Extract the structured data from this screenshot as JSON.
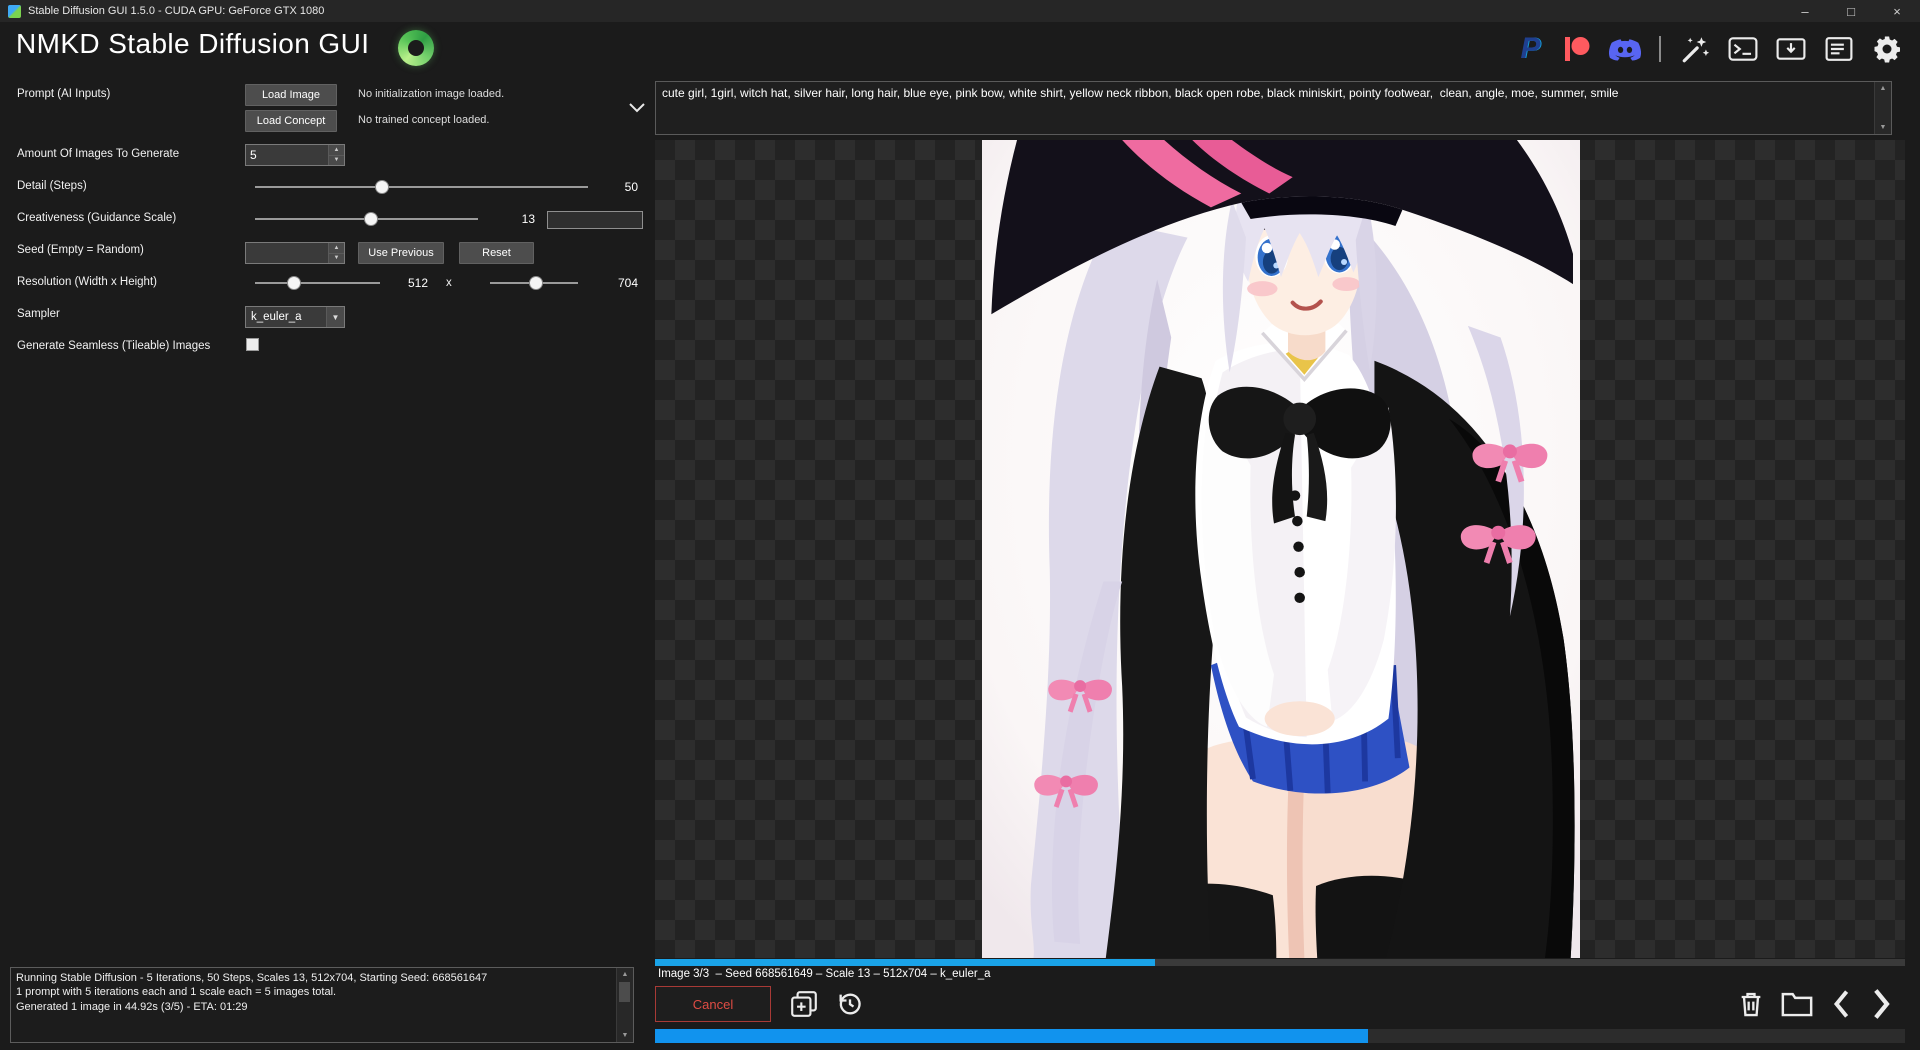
{
  "window": {
    "title": "Stable Diffusion GUI 1.5.0 - CUDA GPU: GeForce GTX 1080",
    "controls": {
      "minimize": "–",
      "maximize": "□",
      "close": "×"
    }
  },
  "header": {
    "app_title": "NMKD Stable Diffusion GUI",
    "icons": [
      "paypal",
      "patreon",
      "discord",
      "post-processing-wand",
      "console",
      "import-image",
      "queue-list",
      "settings-gear"
    ]
  },
  "settings_panel": {
    "prompt_label": "Prompt (AI Inputs)",
    "load_image_button": "Load Image",
    "load_concept_button": "Load Concept",
    "init_image_status": "No initialization image loaded.",
    "concept_status": "No trained concept loaded.",
    "amount_label": "Amount Of Images To Generate",
    "amount_value": "5",
    "steps_label": "Detail (Steps)",
    "steps_value": "50",
    "guidance_label": "Creativeness (Guidance Scale)",
    "guidance_value": "13",
    "seed_label": "Seed (Empty = Random)",
    "seed_value": "",
    "use_previous_button": "Use Previous",
    "reset_button": "Reset",
    "resolution_label": "Resolution (Width x Height)",
    "width_value": "512",
    "resolution_separator": "x",
    "height_value": "704",
    "sampler_label": "Sampler",
    "sampler_value": "k_euler_a",
    "seamless_label": "Generate Seamless (Tileable) Images",
    "seamless_checked": false
  },
  "prompt_box": {
    "text": "cute girl, 1girl, witch hat, silver hair, long hair, blue eye, pink bow, white shirt, yellow neck ribbon, black open robe, black miniskirt, pointy footwear,  clean, angle, moe, summer, smile"
  },
  "viewer": {
    "caption": "Image 3/3  – Seed 668561649 – Scale 13 – 512x704 – k_euler_a",
    "image_progress_percent": 40,
    "overall_progress_percent": 57,
    "buttons": [
      "add-to-collection",
      "history",
      "delete-image",
      "open-output-folder",
      "previous-image",
      "next-image"
    ]
  },
  "log": {
    "lines": [
      "Running Stable Diffusion - 5 Iterations, 50 Steps, Scales 13, 512x704, Starting Seed: 668561647",
      "1 prompt with 5 iterations each and 1 scale each = 5 images total.",
      "Generated 1 image in 44.92s (3/5) - ETA: 01:29"
    ]
  },
  "actions": {
    "cancel_button": "Cancel"
  },
  "colors": {
    "accent_blue": "#1aa3e8",
    "cancel_red": "#df4c44",
    "logo_green": "#57c457",
    "paypal_blue": "#169bd7",
    "patreon_coral": "#ff5a5f",
    "discord_blurple": "#5865f2"
  }
}
